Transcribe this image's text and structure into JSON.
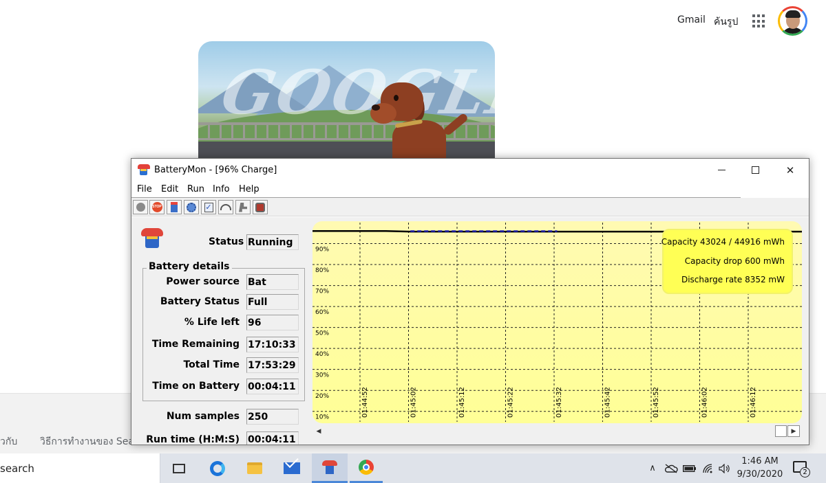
{
  "google": {
    "gmail_label": "Gmail",
    "images_label": "ค้นรูป",
    "footer_link_about": "วกับ",
    "footer_link_how": "วิธีการทำงานของ Sea",
    "doodle_text": "GOOGLE"
  },
  "window": {
    "title": "BatteryMon - [96% Charge]",
    "minimize_glyph": "",
    "close_glyph": "✕",
    "menu": [
      "File",
      "Edit",
      "Run",
      "Info",
      "Help"
    ],
    "toolbar_icons": [
      "circle-icon",
      "stop-icon",
      "battery-icon",
      "gear-info-icon",
      "checklist-icon",
      "gauge-icon",
      "tools-icon",
      "config-icon"
    ],
    "toolbar_stop_text": "STOP",
    "toolbar_check_glyph": "✓"
  },
  "status": {
    "label": "Status",
    "value": "Running"
  },
  "battery_details": {
    "title": "Battery details",
    "rows": [
      {
        "label": "Power source",
        "value": "Bat"
      },
      {
        "label": "Battery Status",
        "value": "Full"
      },
      {
        "label": "% Life left",
        "value": "96"
      },
      {
        "label": "Time Remaining",
        "value": "17:10:33"
      },
      {
        "label": "Total Time",
        "value": "17:53:29"
      },
      {
        "label": "Time on Battery",
        "value": "00:04:11"
      }
    ]
  },
  "samples": {
    "num_label": "Num samples",
    "num_value": "250",
    "run_label": "Run time (H:M:S)",
    "run_value": "00:04:11"
  },
  "chart_data": {
    "type": "line",
    "title": "",
    "xlabel": "",
    "ylabel": "",
    "y_ticks": [
      "90%",
      "80%",
      "70%",
      "60%",
      "50%",
      "40%",
      "30%",
      "20%",
      "10%"
    ],
    "x_ticks": [
      "01:44:52",
      "01:45:02",
      "01:45:12",
      "01:45:22",
      "01:45:32",
      "01:45:42",
      "01:45:52",
      "01:46:02",
      "01:46:12"
    ],
    "ylim": [
      5,
      100
    ],
    "grid": true,
    "series": [
      {
        "values": [
          96,
          96,
          96,
          96,
          95.7,
          95.7,
          95.7,
          95.7,
          95.7,
          95.7,
          95.7,
          95.7,
          95.7,
          95.7,
          95.7,
          95.7,
          95.7,
          95.7,
          95.7,
          95.7,
          95.7
        ],
        "color": "#000000"
      },
      {
        "values": [
          null,
          null,
          null,
          null,
          95.9,
          95.9,
          95.9,
          95.9,
          95.9,
          95.9,
          95.9,
          null,
          null,
          null,
          null,
          null,
          null,
          null,
          null,
          null,
          null
        ],
        "color": "#1a1aa8",
        "dashed": true
      }
    ],
    "info_lines": [
      "Capacity 43024 / 44916 mWh",
      "Capacity drop 600 mWh",
      "Discharge rate 8352 mW"
    ]
  },
  "scrollbar": {
    "left_arrow": "◀",
    "right_arrow": "▶"
  },
  "taskbar": {
    "search_text": "search",
    "time": "1:46 AM",
    "date": "9/30/2020",
    "notification_count": "2",
    "tray_chevron": "∧"
  }
}
